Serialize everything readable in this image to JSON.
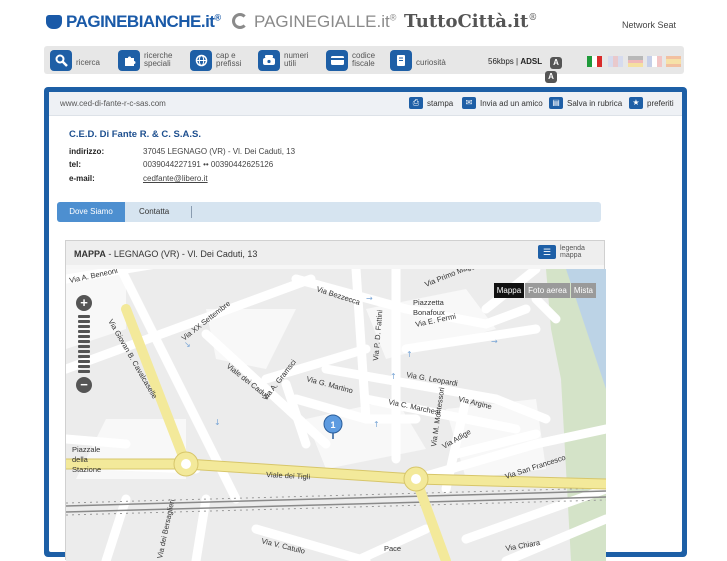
{
  "logos": {
    "paginebianche": "PAGINEBIANCHE.it",
    "paginegialle": "PAGINEGIALLE.it",
    "tuttocitta": "TuttoCittà.it",
    "registered": "®"
  },
  "network_link": "Network Seat",
  "nav": {
    "items": [
      {
        "label": "ricerca",
        "icon": "search-icon"
      },
      {
        "label": "ricerche speciali",
        "icon": "puzzle-icon"
      },
      {
        "label": "cap e prefissi",
        "icon": "globe-icon"
      },
      {
        "label": "numeri utili",
        "icon": "phone-icon"
      },
      {
        "label": "codice fiscale",
        "icon": "card-icon"
      },
      {
        "label": "curiosità",
        "icon": "book-icon"
      }
    ],
    "speed": "56kbps",
    "adsl": "ADSL",
    "font_large": "A",
    "font_small": "A",
    "flags": [
      "italian-flag-icon",
      "english-flag-icon",
      "german-flag-icon",
      "french-flag-icon",
      "spanish-flag-icon"
    ]
  },
  "toolbar": {
    "url": "www.ced-di-fante-r-c-sas.com",
    "print": "stampa",
    "send": "Invia ad un amico",
    "save": "Salva in rubrica",
    "favorites": "preferiti"
  },
  "company": {
    "name": "C.E.D. Di Fante R. & C. S.A.S.",
    "address_label": "indirizzo:",
    "address": "37045 LEGNAGO (VR) - Vl. Dei Caduti, 13",
    "tel_label": "tel:",
    "tel": "0039044227191 •• 00390442625126",
    "email_label": "e-mail:",
    "email": "cedfante@libero.it"
  },
  "tabs": {
    "active": "Dove Siamo",
    "second": "Contatta"
  },
  "map": {
    "title_bold": "MAPPA",
    "title_rest": " - LEGNAGO (VR) - Vl. Dei Caduti, 13",
    "legend_line1": "legenda",
    "legend_line2": "mappa",
    "view_buttons": [
      "Mappa",
      "Foto aerea",
      "Mista"
    ],
    "zoom_in": "+",
    "zoom_out": "−",
    "marker": "1",
    "streets": [
      "Via A. Beneoni",
      "Via Bezzecca",
      "Via Primo Maggio",
      "Piazzetta",
      "Bonafoux",
      "Via E. Fermi",
      "Via XX Settembre",
      "Via Giovan B. Cavalcaselle",
      "Via P. D. Fattini",
      "Viale dei Caduti",
      "Via A. Gramsci",
      "Via G. Martino",
      "Via G. Leopardi",
      "Via C. Marchesi",
      "Via M. Montessori",
      "Via Argine",
      "Via Adige",
      "Piazzale",
      "della",
      "Stazione",
      "Viale dei Tigli",
      "Via San Francesco",
      "Via dei Bersaglieri",
      "Via V. Catullo",
      "Pace",
      "Via Chiara"
    ]
  }
}
